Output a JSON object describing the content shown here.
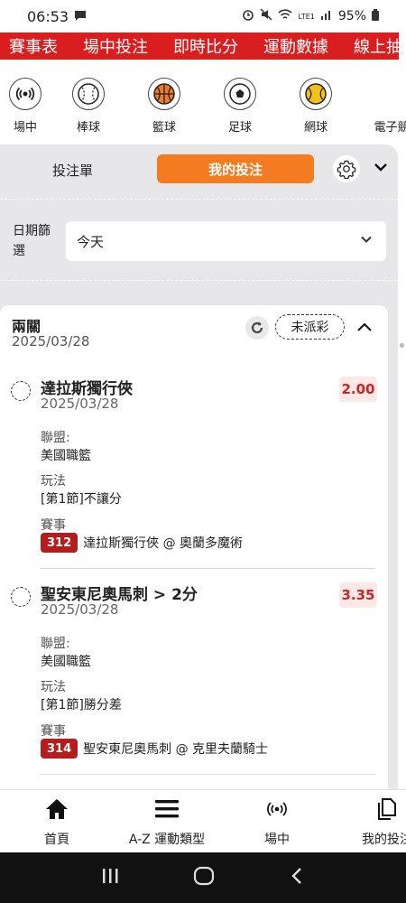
{
  "status_bar": {
    "time": "06:53",
    "network": "LTE1",
    "battery": "95%"
  },
  "top_nav": {
    "items": [
      "賽事表",
      "場中投注",
      "即時比分",
      "運動數據",
      "線上抽"
    ]
  },
  "sports": [
    {
      "label": "場中",
      "icon": "live-icon"
    },
    {
      "label": "棒球",
      "icon": "baseball-icon"
    },
    {
      "label": "籃球",
      "icon": "basketball-icon"
    },
    {
      "label": "足球",
      "icon": "soccer-icon"
    },
    {
      "label": "網球",
      "icon": "tennis-icon"
    },
    {
      "label": "電子競",
      "icon": "esports-icon"
    }
  ],
  "tabs": {
    "bet_slip": "投注單",
    "my_bets": "我的投注"
  },
  "date_filter": {
    "label": "日期篩選",
    "value": "今天"
  },
  "card": {
    "title": "兩關",
    "date": "2025/03/28",
    "status": "未派彩",
    "bets": [
      {
        "name": "達拉斯獨行俠",
        "date": "2025/03/28",
        "odds": "2.00",
        "league_label": "聯盟:",
        "league": "美國職籃",
        "market_label": "玩法",
        "market": "[第1節]不讓分",
        "event_label": "賽事",
        "event_num": "312",
        "event": "達拉斯獨行俠 @ 奧蘭多魔術"
      },
      {
        "name": "聖安東尼奧馬刺 > 2分",
        "date": "2025/03/28",
        "odds": "3.35",
        "league_label": "聯盟:",
        "league": "美國職籃",
        "market_label": "玩法",
        "market": "[第1節]勝分差",
        "event_label": "賽事",
        "event_num": "314",
        "event": "聖安東尼奧馬刺 @ 克里夫蘭騎士"
      }
    ]
  },
  "bottom_nav": [
    {
      "label": "首頁",
      "icon": "home-icon"
    },
    {
      "label": "A-Z 運動類型",
      "icon": "menu-icon"
    },
    {
      "label": "場中",
      "icon": "live-icon"
    },
    {
      "label": "我的投注",
      "icon": "copy-icon"
    }
  ],
  "colors": {
    "brand_red": "#d81e1e",
    "accent_orange": "#f47b1f",
    "odds_red": "#c62828"
  }
}
